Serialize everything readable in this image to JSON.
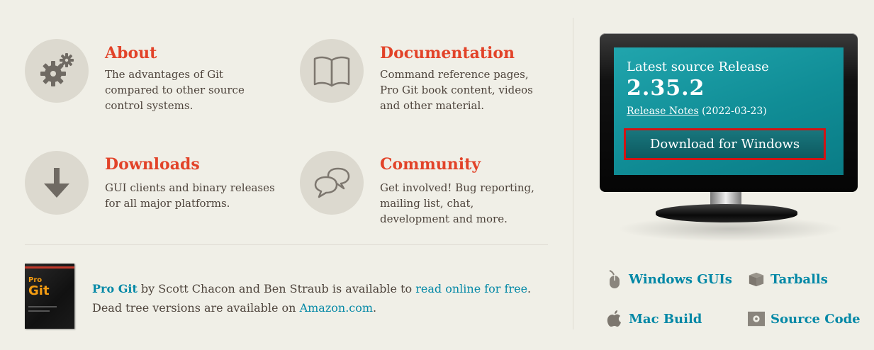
{
  "features": [
    {
      "title": "About",
      "desc": "The advantages of Git compared to other source control systems.",
      "icon": "gears-icon"
    },
    {
      "title": "Documentation",
      "desc": "Command reference pages, Pro Git book content, videos and other material.",
      "icon": "book-icon"
    },
    {
      "title": "Downloads",
      "desc": "GUI clients and binary releases for all major platforms.",
      "icon": "download-arrow-icon"
    },
    {
      "title": "Community",
      "desc": "Get involved! Bug reporting, mailing list, chat, development and more.",
      "icon": "chat-bubbles-icon"
    }
  ],
  "book": {
    "cover_small": "Pro",
    "cover_big": "Git",
    "title": "Pro Git",
    "text1": " by Scott Chacon and Ben Straub is available to ",
    "link1": "read online for free",
    "text2": ". Dead tree versions are available on ",
    "link2": "Amazon.com",
    "text3": "."
  },
  "release": {
    "label": "Latest source Release",
    "version": "2.35.2",
    "notes_link": "Release Notes",
    "date": "(2022-03-23)",
    "download_button": "Download for Windows"
  },
  "links": {
    "windows_guis": "Windows GUIs",
    "tarballs": "Tarballs",
    "mac_build": "Mac Build",
    "source_code": "Source Code"
  },
  "colors": {
    "accent": "#e24329",
    "link": "#0388a6",
    "background": "#f0efe7",
    "screen": "#108d96",
    "highlight_border": "#d11414"
  }
}
